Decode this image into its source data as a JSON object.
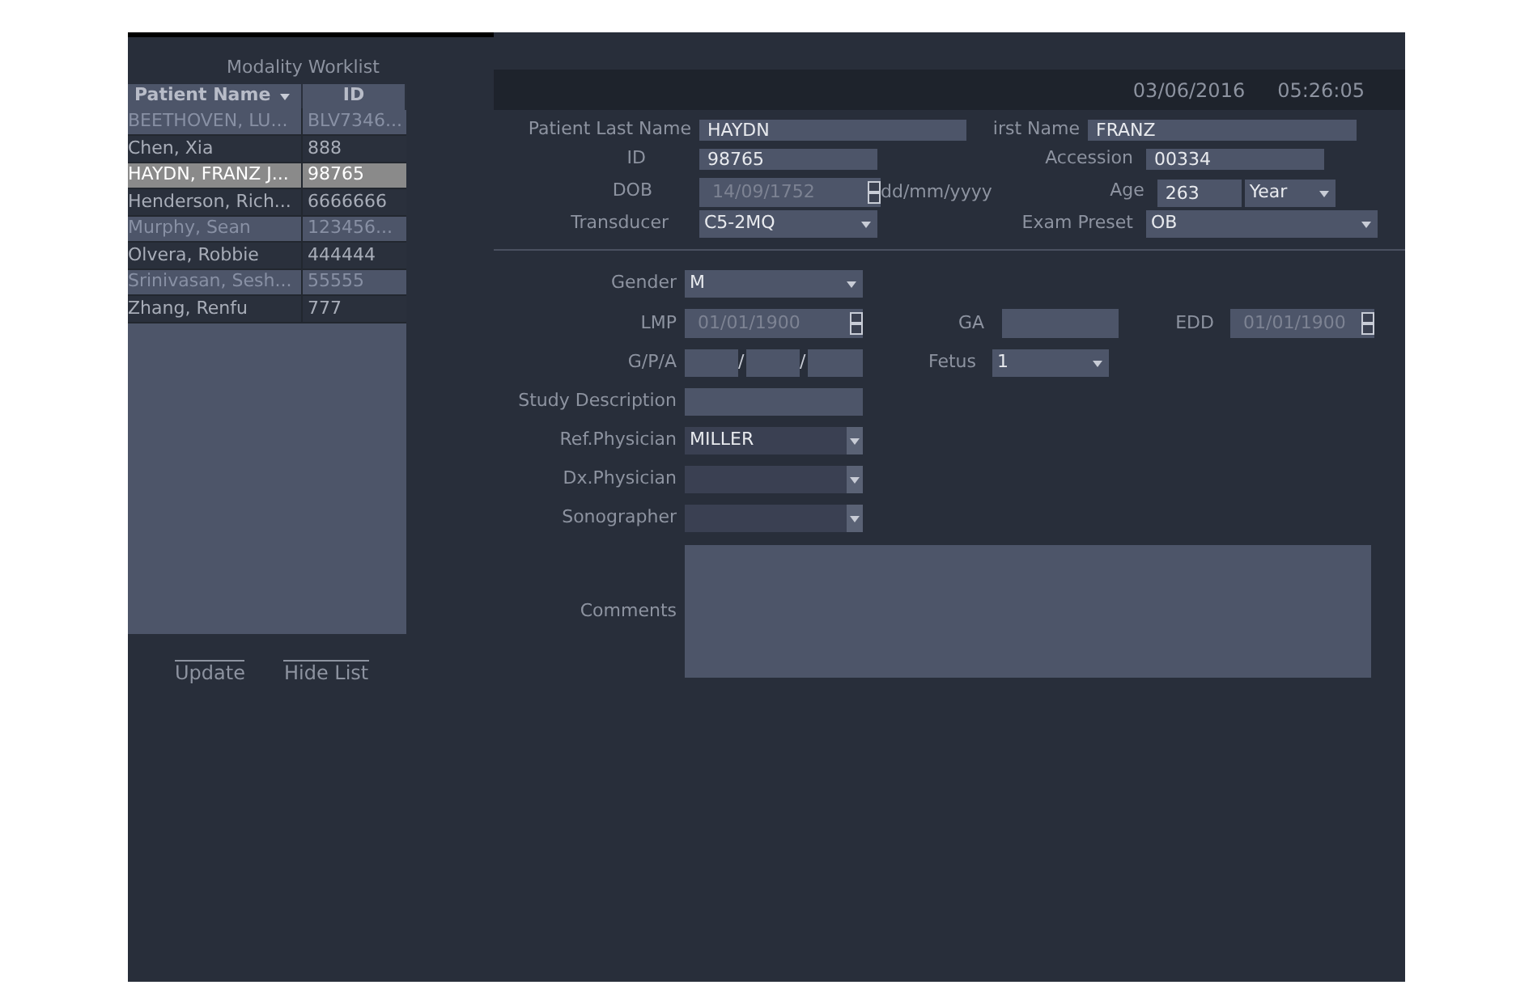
{
  "worklist": {
    "title": "Modality Worklist",
    "columns": [
      {
        "label": "Patient Name",
        "sorted": true
      },
      {
        "label": "ID",
        "sorted": false
      }
    ],
    "rows": [
      {
        "name": "BEETHOVEN, LU...",
        "id": "BLV7346...",
        "selected": false
      },
      {
        "name": "Chen, Xia",
        "id": "888",
        "selected": false
      },
      {
        "name": "HAYDN, FRANZ J...",
        "id": "98765",
        "selected": true
      },
      {
        "name": "Henderson, Rich...",
        "id": "6666666",
        "selected": false
      },
      {
        "name": "Murphy, Sean",
        "id": "123456...",
        "selected": false
      },
      {
        "name": "Olvera, Robbie",
        "id": "444444",
        "selected": false
      },
      {
        "name": "Srinivasan, Sesh...",
        "id": "55555",
        "selected": false
      },
      {
        "name": "Zhang, Renfu",
        "id": "777",
        "selected": false
      }
    ],
    "buttons": [
      "Update",
      "Hide List"
    ]
  },
  "header": {
    "date": "03/06/2016",
    "time": "05:26:05"
  },
  "patient": {
    "last_name": {
      "label": "Patient Last Name",
      "value": "HAYDN"
    },
    "first_name": {
      "label": "irst Name",
      "value": "FRANZ"
    },
    "id": {
      "label": "ID",
      "value": "98765"
    },
    "accession": {
      "label": "Accession",
      "value": "00334"
    },
    "dob": {
      "label": "DOB",
      "value": "14/09/1752",
      "disabled": true,
      "hint": "dd/mm/yyyy"
    },
    "age": {
      "label": "Age",
      "value": "263",
      "unit": "Year"
    },
    "transducer": {
      "label": "Transducer",
      "value": "C5-2MQ"
    },
    "exam_preset": {
      "label": "Exam Preset",
      "value": "OB"
    }
  },
  "exam": {
    "gender": {
      "label": "Gender",
      "value": "M"
    },
    "lmp": {
      "label": "LMP",
      "value": "01/01/1900",
      "disabled": true
    },
    "ga": {
      "label": "GA"
    },
    "edd": {
      "label": "EDD",
      "value": "01/01/1900",
      "disabled": true
    },
    "gpa": {
      "label": "G/P/A",
      "separators": [
        "/",
        "/"
      ]
    },
    "fetus": {
      "label": "Fetus",
      "value": "1"
    },
    "study_description": {
      "label": "Study Description"
    },
    "ref_physician": {
      "label": "Ref.Physician",
      "value": "MILLER"
    },
    "dx_physician": {
      "label": "Dx.Physician"
    },
    "sonographer": {
      "label": "Sonographer"
    },
    "comments": {
      "label": "Comments"
    }
  }
}
